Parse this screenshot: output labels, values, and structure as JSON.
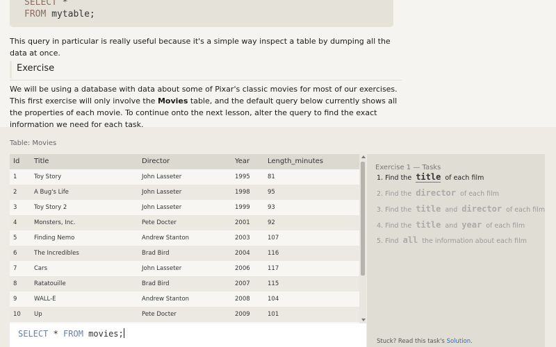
{
  "top_code": {
    "line1_kw": "SELECT",
    "line1_rest": " *",
    "line2_kw": "FROM",
    "line2_rest": " mytable;"
  },
  "intro_paragraph": "This query in particular is really useful because it's a simple way inspect a table by dumping all the data at once.",
  "exercise_heading": "Exercise",
  "exercise_desc": {
    "before": "We will be using a database with data about some of Pixar's classic movies for most of our exercises. This first exercise will only involve the ",
    "bold": "Movies",
    "after": " table, and the default query below currently shows all the properties of each movie. To continue onto the next lesson, alter the query to find the exact information we need for each task."
  },
  "table": {
    "title": "Table: Movies",
    "columns": [
      "Id",
      "Title",
      "Director",
      "Year",
      "Length_minutes"
    ],
    "rows": [
      [
        "1",
        "Toy Story",
        "John Lasseter",
        "1995",
        "81"
      ],
      [
        "2",
        "A Bug's Life",
        "John Lasseter",
        "1998",
        "95"
      ],
      [
        "3",
        "Toy Story 2",
        "John Lasseter",
        "1999",
        "93"
      ],
      [
        "4",
        "Monsters, Inc.",
        "Pete Docter",
        "2001",
        "92"
      ],
      [
        "5",
        "Finding Nemo",
        "Andrew Stanton",
        "2003",
        "107"
      ],
      [
        "6",
        "The Incredibles",
        "Brad Bird",
        "2004",
        "116"
      ],
      [
        "7",
        "Cars",
        "John Lasseter",
        "2006",
        "117"
      ],
      [
        "8",
        "Ratatouille",
        "Brad Bird",
        "2007",
        "115"
      ],
      [
        "9",
        "WALL-E",
        "Andrew Stanton",
        "2008",
        "104"
      ],
      [
        "10",
        "Up",
        "Pete Docter",
        "2009",
        "101"
      ]
    ]
  },
  "editor": {
    "kw1": "SELECT",
    "mid": " * ",
    "kw2": "FROM",
    "rest": " movies;"
  },
  "tasks": {
    "header": "Exercise 1 — Tasks",
    "items": [
      {
        "num": "1. Find the",
        "code1": "title",
        "mid": "of each film",
        "code2": "",
        "tail": ""
      },
      {
        "num": "2. Find the",
        "code1": "director",
        "mid": "of each film",
        "code2": "",
        "tail": ""
      },
      {
        "num": "3. Find the",
        "code1": "title",
        "mid": "and",
        "code2": "director",
        "tail": "of each film"
      },
      {
        "num": "4. Find the",
        "code1": "title",
        "mid": "and",
        "code2": "year",
        "tail": "of each film"
      },
      {
        "num": "5. Find",
        "code1": "all",
        "mid": "the information about each film",
        "code2": "",
        "tail": ""
      }
    ],
    "stuck_text": "Stuck? Read this task's ",
    "stuck_link": "Solution",
    "stuck_end": "."
  }
}
